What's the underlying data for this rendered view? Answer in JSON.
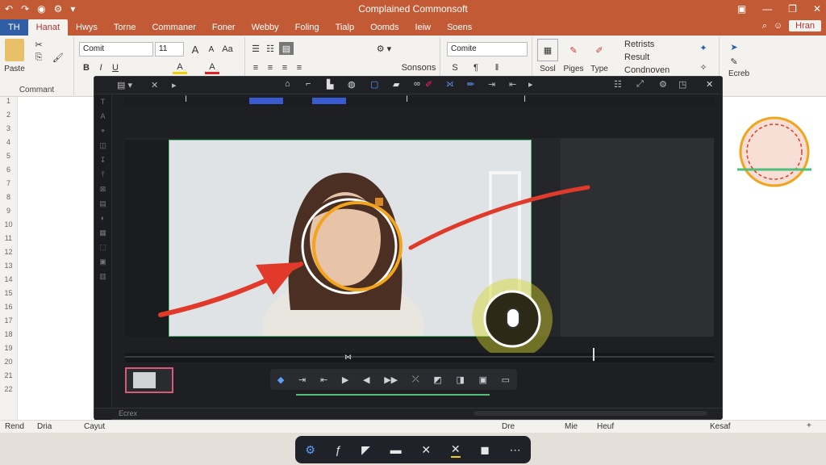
{
  "titlebar": {
    "title": "Complained Commonsoft",
    "quick_access": [
      "↶",
      "↷",
      "◉",
      "⚙",
      "▾"
    ],
    "window_controls": [
      "▣",
      "—",
      "❐",
      "✕"
    ]
  },
  "tabs": {
    "file": "TH",
    "items": [
      "Hanat",
      "Hwys",
      "Torne",
      "Commaner",
      "Foner",
      "Webby",
      "Foling",
      "Tialp",
      "Oomds",
      "Ieiw",
      "Soens"
    ],
    "share": "Hran",
    "search_icon": "search-icon"
  },
  "ribbon": {
    "clipboard": {
      "paste": "Paste",
      "label": "Commant"
    },
    "font": {
      "name": "Comit",
      "size": "11",
      "bold": "B",
      "italic": "I",
      "underline": "U"
    },
    "paragraph": {
      "label": "Sonsons"
    },
    "styles": {
      "name": "Comite",
      "s": "S"
    },
    "editing": {
      "items": [
        "Retrists",
        "Result",
        "Condnoven"
      ],
      "buttons": [
        "Sosl",
        "Piges",
        "Type"
      ]
    },
    "right": {
      "label": "Ecreb"
    }
  },
  "editor": {
    "toolbar_title": "▤ ▾",
    "ruler_marks": [
      "I",
      "I",
      "I"
    ],
    "status_left": "Ecrex",
    "tools": [
      "T",
      "A",
      "⌖",
      "◫",
      "↧",
      "⤒",
      "⊠",
      "▤",
      "◐",
      "▦",
      "⬚",
      "▣",
      "▥"
    ]
  },
  "video": {
    "subject": "woman webcam frame",
    "cursor_icon": "mouse-icon"
  },
  "playbar": {
    "buttons": [
      "◆",
      "⇥",
      "⇤",
      "▶",
      "◀",
      "▶▶",
      "⤫",
      "◩",
      "◨",
      "▣",
      "▭"
    ]
  },
  "statusbar": {
    "left": [
      "Rend",
      "Dria",
      "Cayut"
    ],
    "right": [
      "Dre",
      "Mie",
      "Heuf",
      "Kesaf"
    ],
    "zoom_plus": "+",
    "zoom_minus": "–"
  },
  "floatbar": {
    "buttons": [
      "⚙",
      "ƒ",
      "◤",
      "▬",
      "✕",
      "✕",
      "◼",
      "⋯"
    ]
  },
  "leftruler": [
    "1",
    "2",
    "3",
    "4",
    "5",
    "6",
    "7",
    "8",
    "9",
    "10",
    "11",
    "12",
    "13",
    "14",
    "15",
    "16",
    "17",
    "18",
    "19",
    "20",
    "21",
    "22"
  ],
  "colors": {
    "accent": "#c25a35",
    "arrow_red": "#e23a2a",
    "ring_orange": "#f2a51c",
    "green_border": "#4fbf7a",
    "highlight": "#d7d52a"
  }
}
